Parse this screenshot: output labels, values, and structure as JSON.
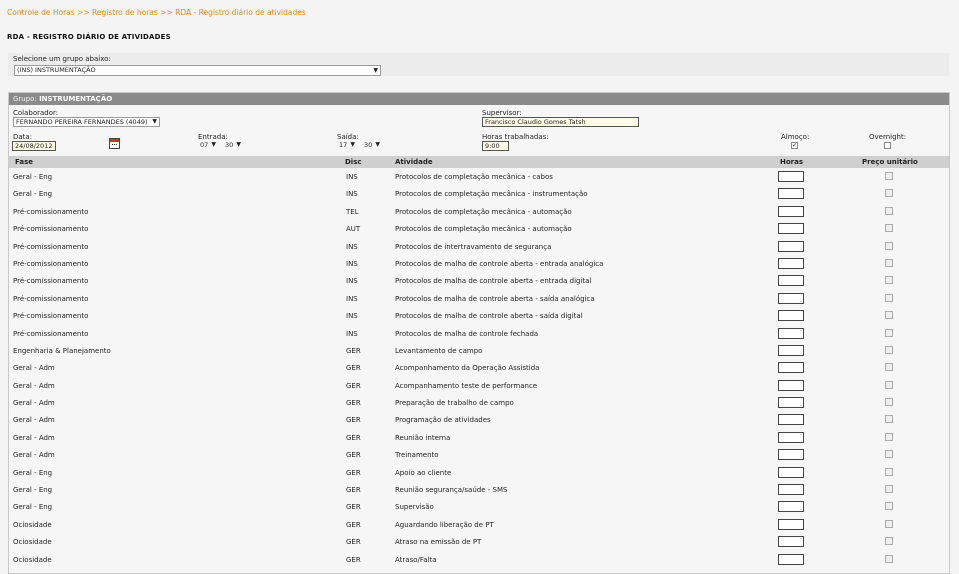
{
  "breadcrumb": {
    "text": "Controle de Horas >> Registro de horas >> RDA - Registro diário de atividades"
  },
  "page_title": "RDA - REGISTRO DIÁRIO DE ATIVIDADES",
  "group_select": {
    "label": "Selecione um grupo abaixo:",
    "value": "(INS) INSTRUMENTAÇÃO"
  },
  "panel": {
    "header_prefix": "Grupo:",
    "header_value": "INSTRUMENTAÇÃO"
  },
  "fields": {
    "colaborador_label": "Colaborador:",
    "colaborador_value": "FERNANDO PEREIRA FERNANDES (4049)",
    "supervisor_label": "Supervisor:",
    "supervisor_value": "Francisco Claudio Gomes Tatsh",
    "data_label": "Data:",
    "data_value": "24/08/2012",
    "entrada_label": "Entrada:",
    "entrada_hour": "07",
    "entrada_min": "30",
    "saida_label": "Saída:",
    "saida_hour": "17",
    "saida_min": "30",
    "horas_label": "Horas trabalhadas:",
    "horas_value": "9:00",
    "almoco_label": "Almoço:",
    "almoco_checked": "✓",
    "overnight_label": "Overnight:"
  },
  "table": {
    "headers": {
      "fase": "Fase",
      "disc": "Disc",
      "atividade": "Atividade",
      "horas": "Horas",
      "preco": "Preço unitário"
    },
    "rows": [
      {
        "fase": "Geral - Eng",
        "disc": "INS",
        "atividade": "Protocolos de completação mecânica - cabos"
      },
      {
        "fase": "Geral - Eng",
        "disc": "INS",
        "atividade": "Protocolos de completação mecânica - instrumentação"
      },
      {
        "fase": "Pré-comissionamento",
        "disc": "TEL",
        "atividade": "Protocolos de completação mecânica - automação"
      },
      {
        "fase": "Pré-comissionamento",
        "disc": "AUT",
        "atividade": "Protocolos de completação mecânica - automação"
      },
      {
        "fase": "Pré-comissionamento",
        "disc": "INS",
        "atividade": "Protocolos de intertravamento de segurança"
      },
      {
        "fase": "Pré-comissionamento",
        "disc": "INS",
        "atividade": "Protocolos de malha de controle aberta - entrada analógica"
      },
      {
        "fase": "Pré-comissionamento",
        "disc": "INS",
        "atividade": "Protocolos de malha de controle aberta - entrada digital"
      },
      {
        "fase": "Pré-comissionamento",
        "disc": "INS",
        "atividade": "Protocolos de malha de controle aberta - saída analógica"
      },
      {
        "fase": "Pré-comissionamento",
        "disc": "INS",
        "atividade": "Protocolos de malha de controle aberta - saída digital"
      },
      {
        "fase": "Pré-comissionamento",
        "disc": "INS",
        "atividade": "Protocolos de malha de controle fechada"
      },
      {
        "fase": "Engenharia & Planejamento",
        "disc": "GER",
        "atividade": "Levantamento de campo"
      },
      {
        "fase": "Geral - Adm",
        "disc": "GER",
        "atividade": "Acompanhamento da Operação Assistida"
      },
      {
        "fase": "Geral - Adm",
        "disc": "GER",
        "atividade": "Acompanhamento teste de performance"
      },
      {
        "fase": "Geral - Adm",
        "disc": "GER",
        "atividade": "Preparação de trabalho de campo"
      },
      {
        "fase": "Geral - Adm",
        "disc": "GER",
        "atividade": "Programação de atividades"
      },
      {
        "fase": "Geral - Adm",
        "disc": "GER",
        "atividade": "Reunião interna"
      },
      {
        "fase": "Geral - Adm",
        "disc": "GER",
        "atividade": "Treinamento"
      },
      {
        "fase": "Geral - Eng",
        "disc": "GER",
        "atividade": "Apoio ao cliente"
      },
      {
        "fase": "Geral - Eng",
        "disc": "GER",
        "atividade": "Reunião segurança/saúde - SMS"
      },
      {
        "fase": "Geral - Eng",
        "disc": "GER",
        "atividade": "Supervisão"
      },
      {
        "fase": "Ociosidade",
        "disc": "GER",
        "atividade": "Aguardando liberação de PT"
      },
      {
        "fase": "Ociosidade",
        "disc": "GER",
        "atividade": "Atraso na emissão de PT"
      },
      {
        "fase": "Ociosidade",
        "disc": "GER",
        "atividade": "Atraso/Falta"
      }
    ]
  },
  "icons": {
    "calendar": "calendar-icon",
    "dropdown": "chevron-down-icon"
  }
}
